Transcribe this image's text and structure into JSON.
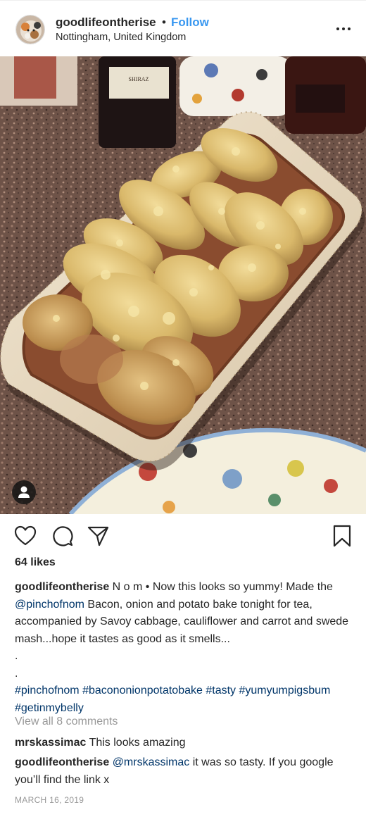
{
  "header": {
    "username": "goodlifeontherise",
    "separator": "•",
    "follow_label": "Follow",
    "location": "Nottingham, United Kingdom",
    "more_icon": "more-horizontal-icon"
  },
  "actions": {
    "like_icon": "heart-icon",
    "comment_icon": "comment-icon",
    "share_icon": "paper-plane-icon",
    "save_icon": "bookmark-icon"
  },
  "likes": "64 likes",
  "caption": {
    "username": "goodlifeontherise",
    "text_1": " N o m • Now this looks so yummy! Made the ",
    "mention": "@pinchofnom",
    "text_2": " Bacon, onion and potato bake tonight for tea, accompanied by Savoy cabbage, cauliflower and carrot and swede mash...hope it tastes as good as it smells...",
    "dot_1": ".",
    "dot_2": ".",
    "hashtags": [
      "#pinchofnom",
      "#bacononionpotatobake",
      "#tasty",
      "#yumyumpigsbum",
      "#getinmybelly"
    ]
  },
  "view_comments": "View all 8 comments",
  "comments": [
    {
      "username": "mrskassimac",
      "text": " This looks amazing"
    },
    {
      "username": "goodlifeontherise",
      "mention": "@mrskassimac",
      "text": " it was so tasty. If you google you’ll find the link x"
    }
  ],
  "date": "MARCH 16, 2019",
  "colors": {
    "link": "#3897f0",
    "hashtag": "#003569",
    "muted": "#999999",
    "text": "#262626"
  }
}
